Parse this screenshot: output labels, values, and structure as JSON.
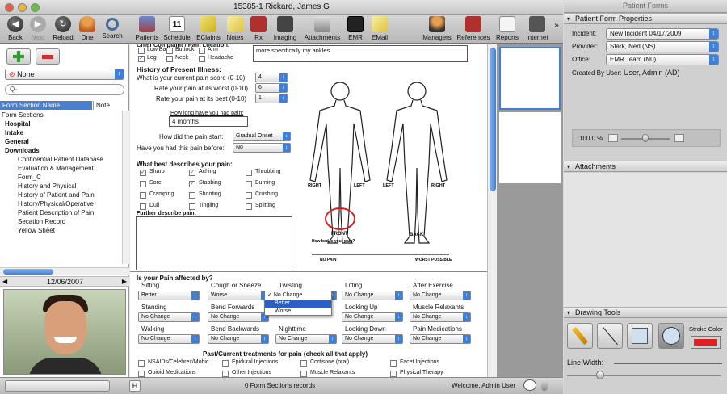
{
  "window_title": "15385-1    Rickard, James G",
  "toolbar": {
    "back": "Back",
    "next": "Next",
    "reload": "Reload",
    "one": "One",
    "search": "Search",
    "patients": "Patients",
    "schedule": "Schedule",
    "eclaims": "EClaims",
    "notes": "Notes",
    "rx": "Rx",
    "imaging": "Imaging",
    "attachments": "Attachments",
    "emr": "EMR",
    "email": "EMail",
    "managers": "Managers",
    "references": "References",
    "reports": "Reports",
    "internet": "Internet",
    "calendar_day": "11"
  },
  "left": {
    "none_label": "None",
    "search_placeholder": "Q-",
    "col_section": "Form Section Name",
    "col_note": "Note",
    "date": "12/06/2007",
    "tree": [
      "Form Sections",
      "Hospital",
      "Intake",
      "General",
      "Downloads",
      "Confidential Patient Database",
      "Evaluation & Management",
      "Form_C",
      "History and Physical",
      "History of Patient and Pain",
      "History/Physical/Operative",
      "Patient Description of Pain",
      "Secation Record",
      "Yellow Sheet"
    ]
  },
  "form": {
    "top_checks": [
      "Low Back",
      "Buttock",
      "Arm",
      "Leg",
      "Neck",
      "Headache"
    ],
    "top_text": "more specifically my ankles",
    "hpi_title": "History of Present Illness:",
    "q_current": "What is your current pain score (0-10)",
    "v_current": "4",
    "q_worst": "Rate your pain at its worst (0-10)",
    "v_worst": "6",
    "q_best": "Rate your pain at its best (0-10)",
    "v_best": "1",
    "q_howlong": "How long have you had pain:",
    "v_howlong": "4 months",
    "q_start": "How did the pain start:",
    "v_start": "Gradual Onset",
    "q_before": "Have you had this pain before:",
    "v_before": "No",
    "q_desc": "What best describes your pain:",
    "desc_opts": [
      {
        "label": "Sharp",
        "checked": true
      },
      {
        "label": "Aching",
        "checked": true
      },
      {
        "label": "Throbbing",
        "checked": false
      },
      {
        "label": "Sore",
        "checked": false
      },
      {
        "label": "Stabbing",
        "checked": true
      },
      {
        "label": "Burning",
        "checked": false
      },
      {
        "label": "Cramping",
        "checked": false
      },
      {
        "label": "Shooting",
        "checked": false
      },
      {
        "label": "Crushing",
        "checked": false
      },
      {
        "label": "Dull",
        "checked": false
      },
      {
        "label": "Tingling",
        "checked": false
      },
      {
        "label": "Splitting",
        "checked": false
      }
    ],
    "further": "Further describe pain:",
    "body_labels": {
      "right1": "RIGHT",
      "left1": "LEFT",
      "left2": "LEFT",
      "right2": "RIGHT",
      "front": "FRONT",
      "back": "BACK",
      "howbad": "How bad is your pain?",
      "nopain": "NO PAIN",
      "worst": "WORST POSSIBLE"
    },
    "affected_title": "Is your Pain affected by?",
    "affected": [
      {
        "label": "Sitting",
        "value": "Better"
      },
      {
        "label": "Cough or Sneeze",
        "value": "Worse"
      },
      {
        "label": "Twisting",
        "value": "No Change"
      },
      {
        "label": "Lifting",
        "value": "No Change"
      },
      {
        "label": "After Exercise",
        "value": "No Change"
      },
      {
        "label": "Standing",
        "value": "No Change"
      },
      {
        "label": "Bend Forwards",
        "value": "No Change"
      },
      {
        "label": "",
        "value": ""
      },
      {
        "label": "Looking Up",
        "value": "No Change"
      },
      {
        "label": "Muscle Relaxants",
        "value": "No Change"
      },
      {
        "label": "Walking",
        "value": "No Change"
      },
      {
        "label": "Bend Backwards",
        "value": "No Change"
      },
      {
        "label": "Nighttime",
        "value": "No Change"
      },
      {
        "label": "Looking Down",
        "value": "No Change"
      },
      {
        "label": "Pain Medications",
        "value": "No Change"
      }
    ],
    "popup": [
      "No Change",
      "Better",
      "Worse"
    ],
    "treat_title": "Past/Current treatments for pain (check all that apply)",
    "treat": [
      "NSAIDs/Celebrex/Mobic",
      "Epidural Injections",
      "Cortisone (oral)",
      "Facet Injections",
      "Opioid Medications",
      "Other Injections",
      "Muscle Relaxants",
      "Physical Therapy"
    ]
  },
  "status": {
    "records": "0 Form Sections records",
    "welcome": "Welcome, Admin User"
  },
  "right": {
    "title": "Patient Forms",
    "props": "Patient Form Properties",
    "incident_l": "Incident:",
    "incident": "New Incident 04/17/2009",
    "provider_l": "Provider:",
    "provider": "Stark, Ned (NS)",
    "office_l": "Office:",
    "office": "EMR Team (N0)",
    "created_l": "Created By User:",
    "created": "User, Admin (AD)",
    "zoom": "100.0 %",
    "attachments": "Attachments",
    "drawing": "Drawing Tools",
    "stroke": "Stroke Color",
    "linewidth": "Line Width:",
    "stroke_color": "#e02020"
  }
}
